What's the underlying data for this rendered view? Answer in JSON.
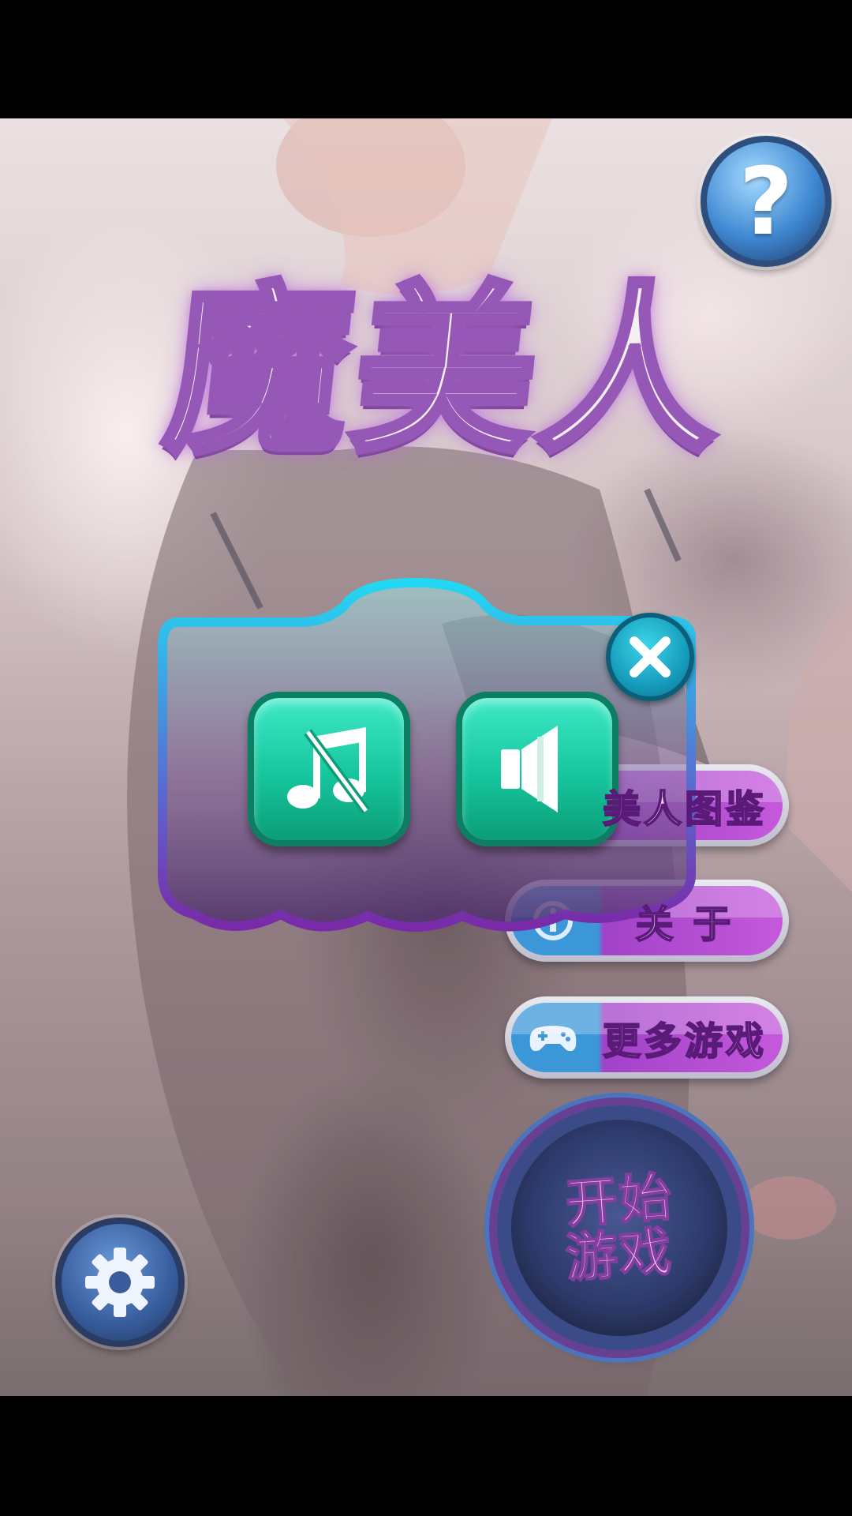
{
  "title": "魔美人",
  "help": {
    "label": "?"
  },
  "menu": {
    "gallery_label": "美人图鉴",
    "about_label": "关 于",
    "more_games_label": "更多游戏"
  },
  "start": {
    "line1": "开始",
    "line2": "游戏"
  },
  "dialog": {
    "music_icon": "music-muted-icon",
    "sound_icon": "speaker-icon",
    "close_icon": "close-icon"
  },
  "colors": {
    "accent_purple": "#9a33c4",
    "accent_blue": "#2c8fd6",
    "dialog_teal": "#15c59c",
    "dialog_border": "#1fd0ee"
  }
}
